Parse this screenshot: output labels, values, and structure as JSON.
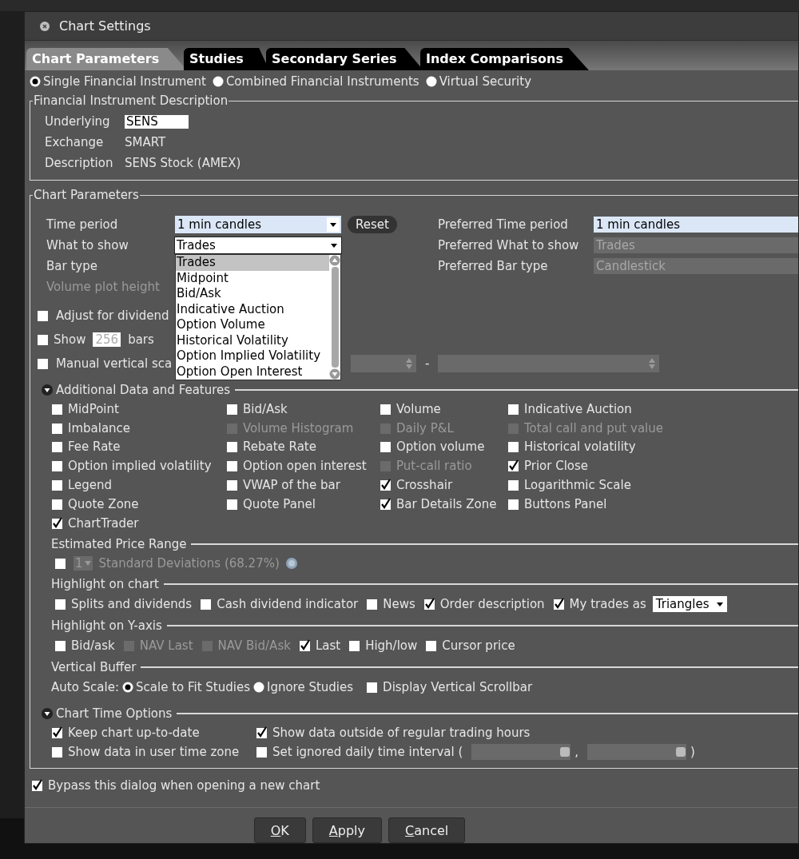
{
  "window": {
    "title": "Chart Settings"
  },
  "tabs": [
    {
      "label": "Chart Parameters",
      "selected": true
    },
    {
      "label": "Studies",
      "selected": false
    },
    {
      "label": "Secondary Series",
      "selected": false
    },
    {
      "label": "Index Comparisons",
      "selected": false
    }
  ],
  "instrument_types": [
    {
      "label": "Single Financial Instrument",
      "selected": true
    },
    {
      "label": "Combined Financial Instruments",
      "selected": false
    },
    {
      "label": "Virtual Security",
      "selected": false
    }
  ],
  "instrument_description": {
    "title": "Financial Instrument Description",
    "fields": [
      {
        "label": "Underlying",
        "value": "SENS",
        "kind": "input"
      },
      {
        "label": "Exchange",
        "value": "SMART",
        "kind": "text"
      },
      {
        "label": "Description",
        "value": "SENS Stock (AMEX)",
        "kind": "text"
      }
    ]
  },
  "chart_parameters": {
    "title": "Chart Parameters",
    "rows": [
      {
        "label": "Time period",
        "disabled": false,
        "value": "1 min candles",
        "kind": "combo"
      },
      {
        "label": "What to show",
        "disabled": false,
        "value": "Trades",
        "kind": "dropdown",
        "expanded": true,
        "options": [
          {
            "label": "Trades",
            "selected": true
          },
          {
            "label": "Midpoint",
            "selected": false
          },
          {
            "label": "Bid/Ask",
            "selected": false
          },
          {
            "label": "Indicative Auction",
            "selected": false
          },
          {
            "label": "Option Volume",
            "selected": false
          },
          {
            "label": "Historical Volatility",
            "selected": false
          },
          {
            "label": "Option Implied Volatility",
            "selected": false
          },
          {
            "label": "Option Open Interest",
            "selected": false
          }
        ]
      },
      {
        "label": "Bar type",
        "disabled": false,
        "kind": "label"
      },
      {
        "label": "Volume plot height",
        "disabled": true,
        "kind": "label"
      }
    ],
    "reset_button": "Reset",
    "preferred": [
      {
        "label": "Preferred Time period",
        "value": "1 min candles",
        "disabled": false
      },
      {
        "label": "Preferred What to show",
        "value": "Trades",
        "disabled": true
      },
      {
        "label": "Preferred Bar type",
        "value": "Candlestick",
        "disabled": true
      }
    ],
    "adjust_dividends": {
      "label": "Adjust for dividend",
      "checked": false
    },
    "show_bars": {
      "checked": false,
      "label": "Show",
      "value": "256",
      "unit": "bars"
    },
    "manual_scale": {
      "label": "Manual vertical sca",
      "checked": false,
      "separator": "-"
    }
  },
  "additional_data": {
    "title": "Additional Data and Features",
    "expanded": true,
    "items": [
      {
        "label": "MidPoint",
        "checked": false,
        "disabled": false
      },
      {
        "label": "Bid/Ask",
        "checked": false,
        "disabled": false
      },
      {
        "label": "Volume",
        "checked": false,
        "disabled": false
      },
      {
        "label": "Indicative Auction",
        "checked": false,
        "disabled": false
      },
      {
        "label": "Imbalance",
        "checked": false,
        "disabled": false
      },
      {
        "label": "Volume Histogram",
        "checked": false,
        "disabled": true
      },
      {
        "label": "Daily P&L",
        "checked": false,
        "disabled": true
      },
      {
        "label": "Total call and put value",
        "checked": false,
        "disabled": true
      },
      {
        "label": "Fee Rate",
        "checked": false,
        "disabled": false
      },
      {
        "label": "Rebate Rate",
        "checked": false,
        "disabled": false
      },
      {
        "label": "Option volume",
        "checked": false,
        "disabled": false
      },
      {
        "label": "Historical volatility",
        "checked": false,
        "disabled": false
      },
      {
        "label": "Option implied volatility",
        "checked": false,
        "disabled": false
      },
      {
        "label": "Option open interest",
        "checked": false,
        "disabled": false
      },
      {
        "label": "Put-call ratio",
        "checked": false,
        "disabled": true
      },
      {
        "label": "Prior Close",
        "checked": true,
        "disabled": false
      },
      {
        "label": "Legend",
        "checked": false,
        "disabled": false
      },
      {
        "label": "VWAP of the bar",
        "checked": false,
        "disabled": false
      },
      {
        "label": "Crosshair",
        "checked": true,
        "disabled": false
      },
      {
        "label": "Logarithmic Scale",
        "checked": false,
        "disabled": false
      },
      {
        "label": "Quote Zone",
        "checked": false,
        "disabled": false
      },
      {
        "label": "Quote Panel",
        "checked": false,
        "disabled": false
      },
      {
        "label": "Bar Details Zone",
        "checked": true,
        "disabled": false
      },
      {
        "label": "Buttons Panel",
        "checked": false,
        "disabled": false
      },
      {
        "label": "ChartTrader",
        "checked": true,
        "disabled": false
      }
    ]
  },
  "estimated_price_range": {
    "title": "Estimated Price Range",
    "checked": false,
    "value": "1",
    "label": "Standard Deviations (68.27%)"
  },
  "highlight_on_chart": {
    "title": "Highlight on chart",
    "items": [
      {
        "label": "Splits and dividends",
        "checked": false,
        "disabled": false
      },
      {
        "label": "Cash dividend indicator",
        "checked": false,
        "disabled": false
      },
      {
        "label": "News",
        "checked": false,
        "disabled": false
      },
      {
        "label": "Order description",
        "checked": true,
        "disabled": false
      },
      {
        "label": "My trades as",
        "checked": true,
        "disabled": false,
        "select": "Triangles"
      }
    ]
  },
  "highlight_on_y_axis": {
    "title": "Highlight on Y-axis",
    "items": [
      {
        "label": "Bid/ask",
        "checked": false,
        "disabled": false
      },
      {
        "label": "NAV Last",
        "checked": false,
        "disabled": true
      },
      {
        "label": "NAV Bid/Ask",
        "checked": false,
        "disabled": true
      },
      {
        "label": "Last",
        "checked": true,
        "disabled": false
      },
      {
        "label": "High/low",
        "checked": false,
        "disabled": false
      },
      {
        "label": "Cursor price",
        "checked": false,
        "disabled": false
      }
    ]
  },
  "vertical_buffer": {
    "title": "Vertical Buffer",
    "auto_scale_label": "Auto Scale:",
    "options": [
      {
        "label": "Scale to Fit Studies",
        "selected": true
      },
      {
        "label": "Ignore Studies",
        "selected": false
      }
    ],
    "scrollbar": {
      "label": "Display Vertical Scrollbar",
      "checked": false
    }
  },
  "chart_time_options": {
    "title": "Chart Time Options",
    "expanded": true,
    "items": [
      {
        "label": "Keep chart up-to-date",
        "checked": true
      },
      {
        "label": "Show data outside of regular trading hours",
        "checked": true
      },
      {
        "label": "Show data in user time zone",
        "checked": false
      },
      {
        "label": "Set ignored daily time interval (",
        "checked": false,
        "kind": "interval",
        "separator": ",",
        "close": ")"
      }
    ]
  },
  "bypass": {
    "label": "Bypass this dialog when opening a new chart",
    "checked": true
  },
  "buttons": [
    {
      "mnemonic": "O",
      "rest": "K"
    },
    {
      "mnemonic": "A",
      "rest": "pply"
    },
    {
      "mnemonic": "C",
      "rest": "ancel"
    }
  ]
}
